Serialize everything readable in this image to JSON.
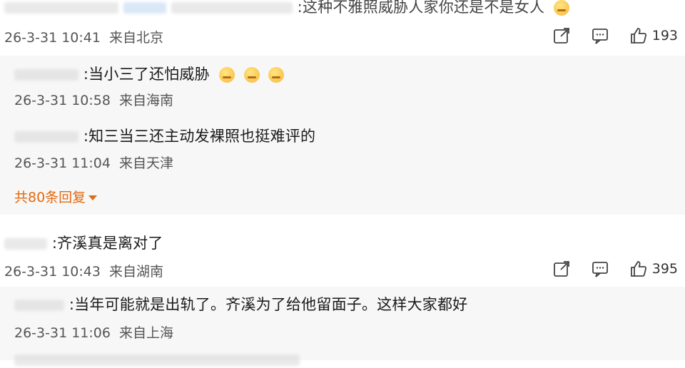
{
  "comments": [
    {
      "text": ":这种不雅照威胁人家你还是不是女人",
      "date": "26-3-31 10:41",
      "location": "来自北京",
      "likes": "193"
    },
    {
      "text": ":齐溪真是离对了",
      "date": "26-3-31 10:43",
      "location": "来自湖南",
      "likes": "395"
    }
  ],
  "replies_group_1": [
    {
      "text": ":当小三了还怕威胁",
      "date": "26-3-31 10:58",
      "location": "来自海南"
    },
    {
      "text": ":知三当三还主动发裸照也挺难评的",
      "date": "26-3-31 11:04",
      "location": "来自天津"
    }
  ],
  "more_replies_label": "共80条回复",
  "replies_group_2": [
    {
      "text": ":当年可能就是出轨了。齐溪为了给他留面子。这样大家都好",
      "date": "26-3-31 11:06",
      "location": "来自上海"
    }
  ],
  "icons": {
    "share": "share-icon",
    "comment": "comment-icon",
    "like": "thumbs-up-icon",
    "more": "caret-down-icon"
  },
  "colors": {
    "accent": "#e2690f",
    "meta": "#555555",
    "reply_bg": "#f7f7f7"
  }
}
